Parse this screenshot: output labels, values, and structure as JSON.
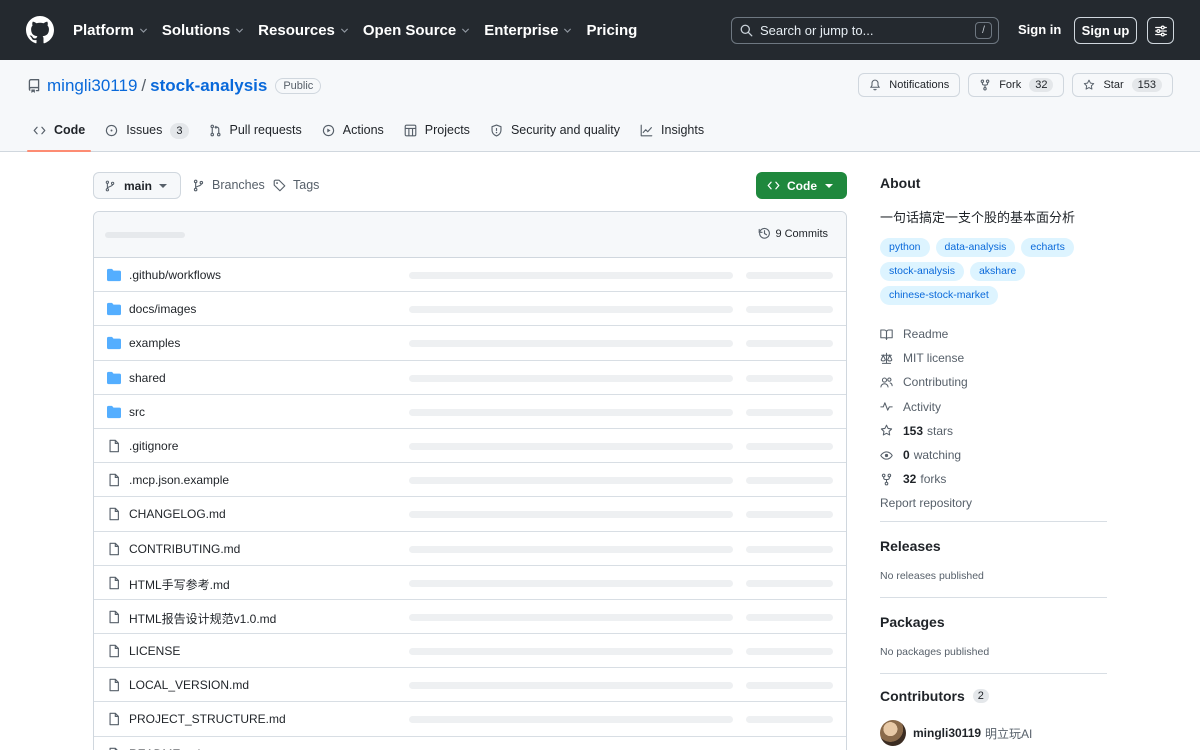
{
  "header": {
    "nav": [
      "Platform",
      "Solutions",
      "Resources",
      "Open Source",
      "Enterprise",
      "Pricing"
    ],
    "nav_has_menu": [
      true,
      true,
      true,
      true,
      true,
      false
    ],
    "search_placeholder": "Search or jump to...",
    "search_key": "/",
    "signin": "Sign in",
    "signup": "Sign up"
  },
  "repo": {
    "owner": "mingli30119",
    "separator": "/",
    "name": "stock-analysis",
    "visibility": "Public",
    "notifications_label": "Notifications",
    "fork_label": "Fork",
    "fork_count": "32",
    "star_label": "Star",
    "star_count": "153"
  },
  "tabs": [
    {
      "label": "Code",
      "icon": "code-icon",
      "selected": true
    },
    {
      "label": "Issues",
      "icon": "issue-opened-icon",
      "count": "3"
    },
    {
      "label": "Pull requests",
      "icon": "git-pull-request-icon"
    },
    {
      "label": "Actions",
      "icon": "play-icon"
    },
    {
      "label": "Projects",
      "icon": "table-icon"
    },
    {
      "label": "Security and quality",
      "icon": "shield-icon"
    },
    {
      "label": "Insights",
      "icon": "graph-icon"
    }
  ],
  "toolbar": {
    "branch": "main",
    "branches_label": "Branches",
    "tags_label": "Tags",
    "code_button": "Code",
    "commits": "9 Commits"
  },
  "files": [
    {
      "name": ".github/workflows",
      "type": "dir"
    },
    {
      "name": "docs/images",
      "type": "dir"
    },
    {
      "name": "examples",
      "type": "dir"
    },
    {
      "name": "shared",
      "type": "dir"
    },
    {
      "name": "src",
      "type": "dir"
    },
    {
      "name": ".gitignore",
      "type": "file"
    },
    {
      "name": ".mcp.json.example",
      "type": "file"
    },
    {
      "name": "CHANGELOG.md",
      "type": "file"
    },
    {
      "name": "CONTRIBUTING.md",
      "type": "file"
    },
    {
      "name": "HTML手写参考.md",
      "type": "file"
    },
    {
      "name": "HTML报告设计规范v1.0.md",
      "type": "file"
    },
    {
      "name": "LICENSE",
      "type": "file"
    },
    {
      "name": "LOCAL_VERSION.md",
      "type": "file"
    },
    {
      "name": "PROJECT_STRUCTURE.md",
      "type": "file"
    },
    {
      "name": "README.md",
      "type": "file"
    }
  ],
  "about": {
    "title": "About",
    "description": "一句话搞定一支个股的基本面分析",
    "topics": [
      "python",
      "data-analysis",
      "echarts",
      "stock-analysis",
      "akshare",
      "chinese-stock-market"
    ],
    "links": [
      {
        "icon": "book-icon",
        "label": "Readme"
      },
      {
        "icon": "law-icon",
        "label": "MIT license"
      },
      {
        "icon": "people-icon",
        "label": "Contributing"
      },
      {
        "icon": "pulse-icon",
        "label": "Activity"
      },
      {
        "icon": "star-icon",
        "strong": "153",
        "label": "stars"
      },
      {
        "icon": "eye-icon",
        "strong": "0",
        "label": "watching"
      },
      {
        "icon": "repo-forked-icon",
        "strong": "32",
        "label": "forks"
      },
      {
        "icon": "",
        "label": "Report repository"
      }
    ]
  },
  "releases": {
    "title": "Releases",
    "empty": "No releases published"
  },
  "packages": {
    "title": "Packages",
    "empty": "No packages published"
  },
  "contributors": {
    "title": "Contributors",
    "count": "2",
    "first": {
      "login": "mingli30119",
      "name": "明立玩AI"
    }
  },
  "colors": {
    "accent": "#0969da",
    "header_bg": "#24292f",
    "code_button": "#1f883d",
    "tab_underline": "#fd8c73",
    "folder": "#54aeff"
  }
}
